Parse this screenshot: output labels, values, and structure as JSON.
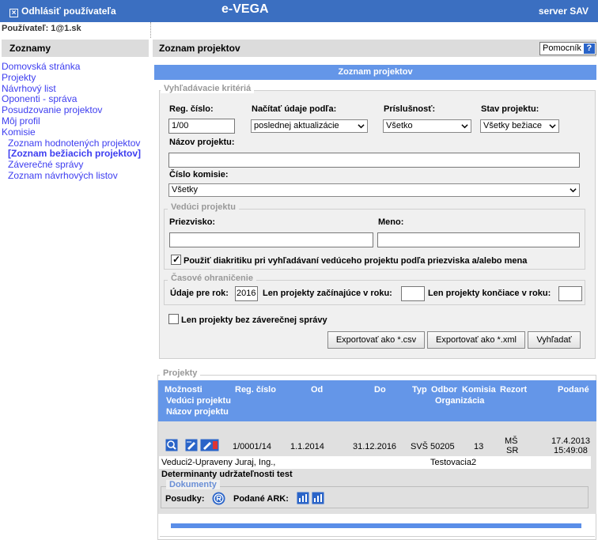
{
  "topbar": {
    "logout_label": "Odhlásiť používateľa",
    "app_name": "e-VEGA",
    "server": "server SAV"
  },
  "user_line": "Používateľ: 1@1.sk",
  "left_header": "Zoznamy",
  "main_header": "Zoznam projektov",
  "help_label": "Pomocník",
  "nav": {
    "home": "Domovská stránka",
    "projects": "Projekty",
    "proposals": "Návrhový list",
    "opponents": "Oponenti - správa",
    "reviews": "Posudzovanie projektov",
    "profile": "Môj profil",
    "commission": "Komisie",
    "sub_rated": "Zoznam hodnotených projektov",
    "sub_running": "[Zoznam bežiacich projektov]",
    "sub_final": "Záverečné správy",
    "sub_proposal": "Zoznam návrhových listov"
  },
  "list_title": "Zoznam projektov",
  "search": {
    "legend": "Vyhľadávacie kritériá",
    "reg_label": "Reg. číslo:",
    "reg_value": "1/00",
    "load_label": "Načítať údaje podľa:",
    "load_value": "poslednej aktualizácie",
    "affil_label": "Príslušnosť:",
    "affil_value": "Všetko",
    "state_label": "Stav projektu:",
    "state_value": "Všetky bežiace",
    "name_label": "Názov projektu:",
    "commission_label": "Číslo komisie:",
    "commission_value": "Všetky",
    "leader_legend": "Vedúci projektu",
    "surname_label": "Priezvisko:",
    "firstname_label": "Meno:",
    "diacritics_label": "Použiť diakritiku pri vyhľadávaní vedúceho projektu podľa priezviska a/alebo mena",
    "diacritics_checked": true,
    "time_legend": "Časové ohraničenie",
    "year_label": "Údaje pre rok:",
    "year_value": "2016",
    "starting_label": "Len projekty začínajúce v roku:",
    "ending_label": "Len projekty končiace v roku:",
    "no_report_label": "Len projekty bez záverečnej správy",
    "no_report_checked": false,
    "export_csv": "Exportovať ako *.csv",
    "export_xml": "Exportovať ako *.xml",
    "search_btn": "Vyhľadať"
  },
  "projects": {
    "legend": "Projekty",
    "headers": {
      "options": "Možnosti",
      "leader": "Vedúci projektu",
      "name": "Názov projektu",
      "reg": "Reg. číslo",
      "from": "Od",
      "to": "Do",
      "type": "Typ",
      "field": "Odbor",
      "org": "Organizácia",
      "commission": "Komisia",
      "ministry": "Rezort",
      "submitted": "Podané"
    },
    "row": {
      "reg": "1/0001/14",
      "from": "1.1.2014",
      "to": "31.12.2016",
      "type": "SVŠ",
      "field": "50205",
      "commission": "13",
      "ministry_1": "MŠ",
      "ministry_2": "SR",
      "submitted_date": "17.4.2013",
      "submitted_time": "15:49:08",
      "leader": "Veduci2-Upraveny Juraj, Ing.,",
      "org": "Testovacia2",
      "name": "Determinanty udržateľnosti test",
      "docs_legend": "Dokumenty",
      "reviews_label": "Posudky:",
      "ark_label": "Podané ARK:"
    }
  },
  "colors": {
    "accent": "#3b6fc1",
    "table_header": "#6496e8",
    "link": "#3d3df0"
  }
}
